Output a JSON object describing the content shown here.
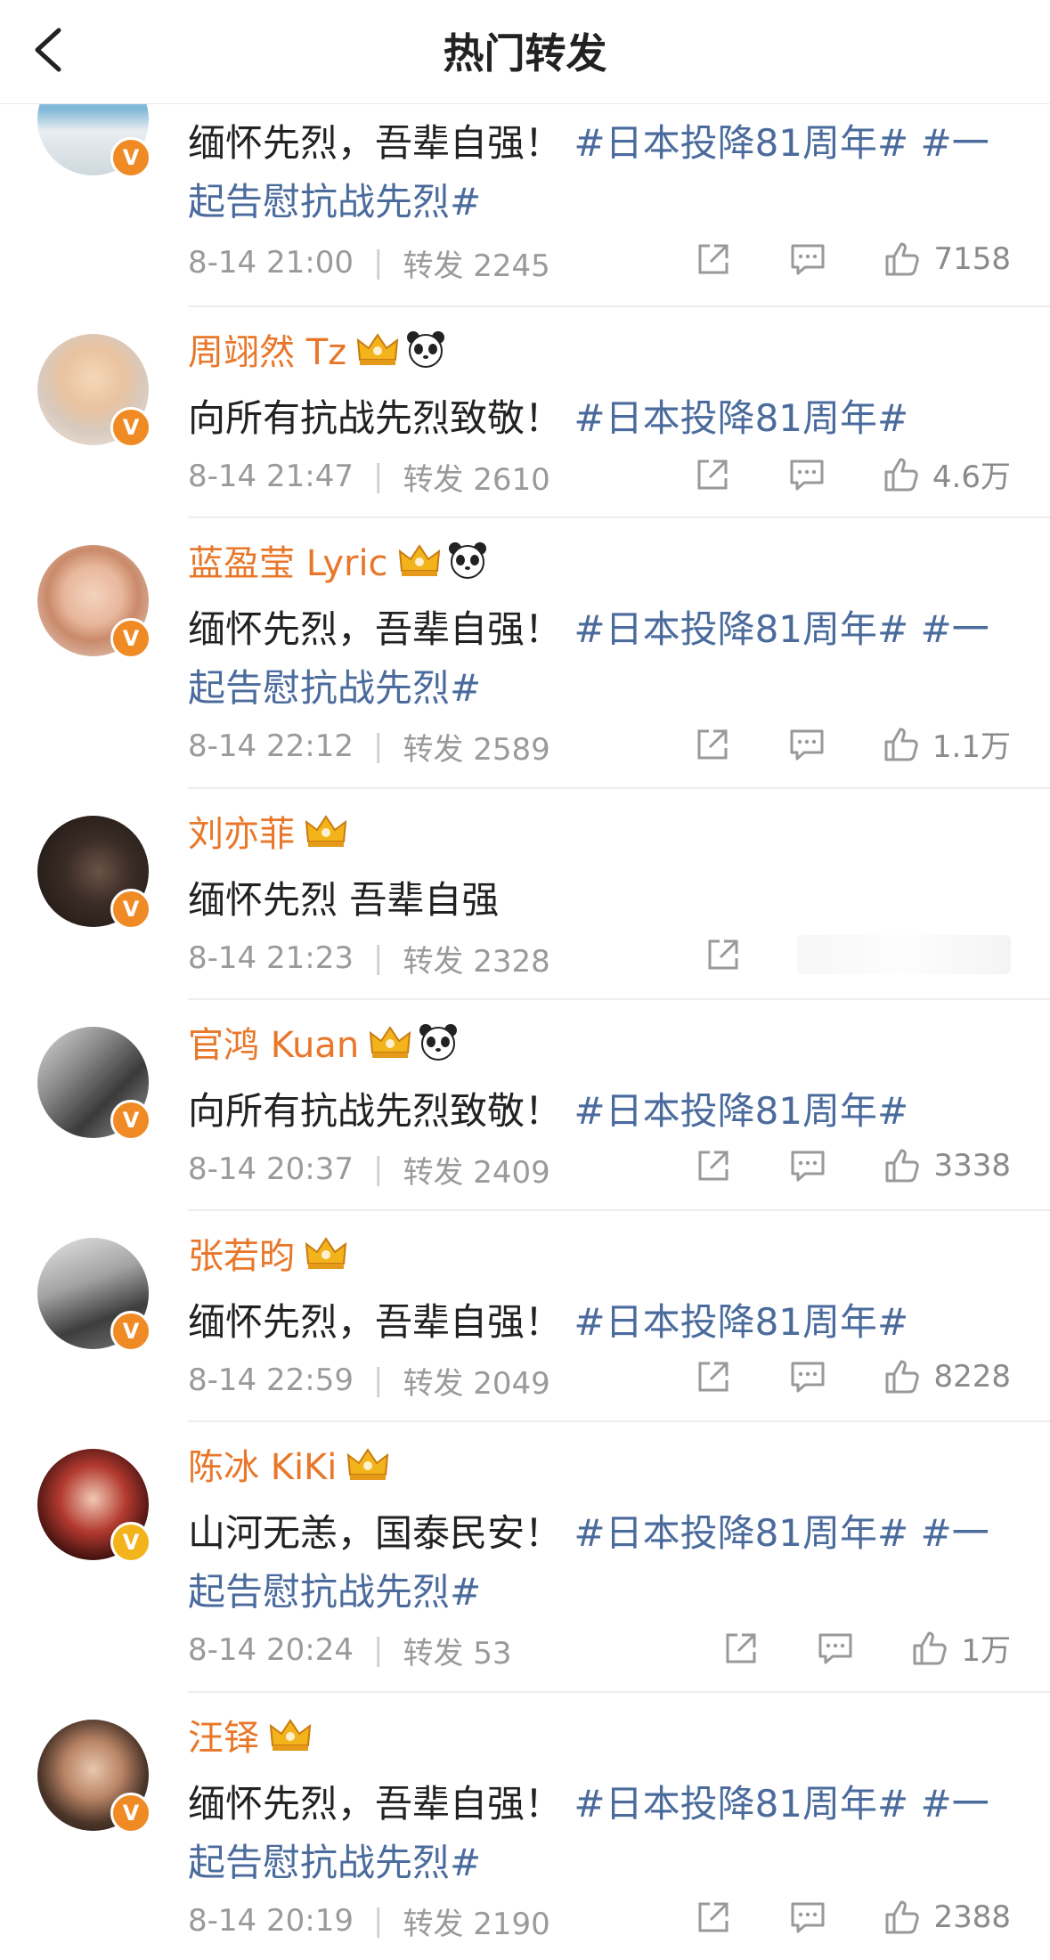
{
  "header": {
    "title": "热门转发"
  },
  "accent": {
    "name": "#e8772a",
    "hashtag": "#4a6b9c",
    "badge_orange": "#f08a24",
    "badge_gold": "#f2b31b"
  },
  "posts": [
    {
      "name": "",
      "badges": [],
      "text_plain": "缅怀先烈，吾辈自强！",
      "text_tags": "#日本投降81周年# #一起告慰抗战先烈#",
      "time": "8-14 21:00",
      "repost_label": "转发",
      "reposts": "2245",
      "likes": "7158",
      "verified_color": "orange"
    },
    {
      "name": "周翊然 Tz",
      "badges": [
        "crown-icon",
        "panda-icon"
      ],
      "text_plain": "向所有抗战先烈致敬！",
      "text_tags": "#日本投降81周年#",
      "time": "8-14 21:47",
      "repost_label": "转发",
      "reposts": "2610",
      "likes": "4.6万",
      "verified_color": "orange"
    },
    {
      "name": "蓝盈莹 Lyric",
      "badges": [
        "crown-icon",
        "panda-icon"
      ],
      "text_plain": "缅怀先烈，吾辈自强！",
      "text_tags": "#日本投降81周年# #一起告慰抗战先烈#",
      "time": "8-14 22:12",
      "repost_label": "转发",
      "reposts": "2589",
      "likes": "1.1万",
      "verified_color": "orange"
    },
    {
      "name": "刘亦菲",
      "badges": [
        "crown-icon"
      ],
      "text_plain": "缅怀先烈 吾辈自强",
      "text_tags": "",
      "time": "8-14 21:23",
      "repost_label": "转发",
      "reposts": "2328",
      "likes": "",
      "verified_color": "orange"
    },
    {
      "name": "官鸿 Kuan",
      "badges": [
        "crown-icon",
        "panda-icon"
      ],
      "text_plain": "向所有抗战先烈致敬！",
      "text_tags": "#日本投降81周年#",
      "time": "8-14 20:37",
      "repost_label": "转发",
      "reposts": "2409",
      "likes": "3338",
      "verified_color": "orange"
    },
    {
      "name": "张若昀",
      "badges": [
        "crown-icon"
      ],
      "text_plain": "缅怀先烈，吾辈自强！",
      "text_tags": "#日本投降81周年#",
      "time": "8-14 22:59",
      "repost_label": "转发",
      "reposts": "2049",
      "likes": "8228",
      "verified_color": "orange"
    },
    {
      "name": "陈冰 KiKi",
      "badges": [
        "crown-icon"
      ],
      "text_plain": "山河无恙，国泰民安！",
      "text_tags": "#日本投降81周年# #一起告慰抗战先烈#",
      "time": "8-14 20:24",
      "repost_label": "转发",
      "reposts": "53",
      "likes": "1万",
      "verified_color": "gold"
    },
    {
      "name": "汪铎",
      "badges": [
        "crown-icon"
      ],
      "text_plain": "缅怀先烈，吾辈自强！",
      "text_tags": "#日本投降81周年# #一起告慰抗战先烈#",
      "time": "8-14 20:19",
      "repost_label": "转发",
      "reposts": "2190",
      "likes": "2388",
      "verified_color": "orange"
    }
  ]
}
